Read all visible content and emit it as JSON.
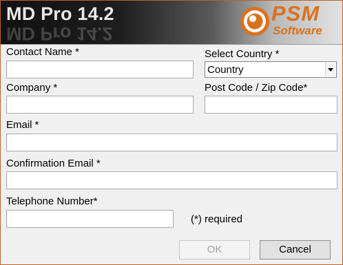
{
  "header": {
    "app_title": "MD Pro 14.2",
    "logo_brand": "PSM",
    "logo_sub": "Software"
  },
  "form": {
    "contact_name": {
      "label": "Contact Name *",
      "value": ""
    },
    "company": {
      "label": "Company *",
      "value": ""
    },
    "email": {
      "label": "Email *",
      "value": ""
    },
    "confirmation_email": {
      "label": "Confirmation Email *",
      "value": ""
    },
    "telephone": {
      "label": "Telephone Number*",
      "value": ""
    },
    "country": {
      "label": "Select Country *",
      "selected": "Country"
    },
    "post_code": {
      "label": "Post Code / Zip Code*",
      "value": ""
    },
    "required_note": "(*) required"
  },
  "buttons": {
    "ok_label": "OK",
    "ok_enabled": false,
    "cancel_label": "Cancel"
  },
  "colors": {
    "window_border": "#b8632a",
    "brand_orange": "#d9721f",
    "background": "#f0f0f0"
  }
}
